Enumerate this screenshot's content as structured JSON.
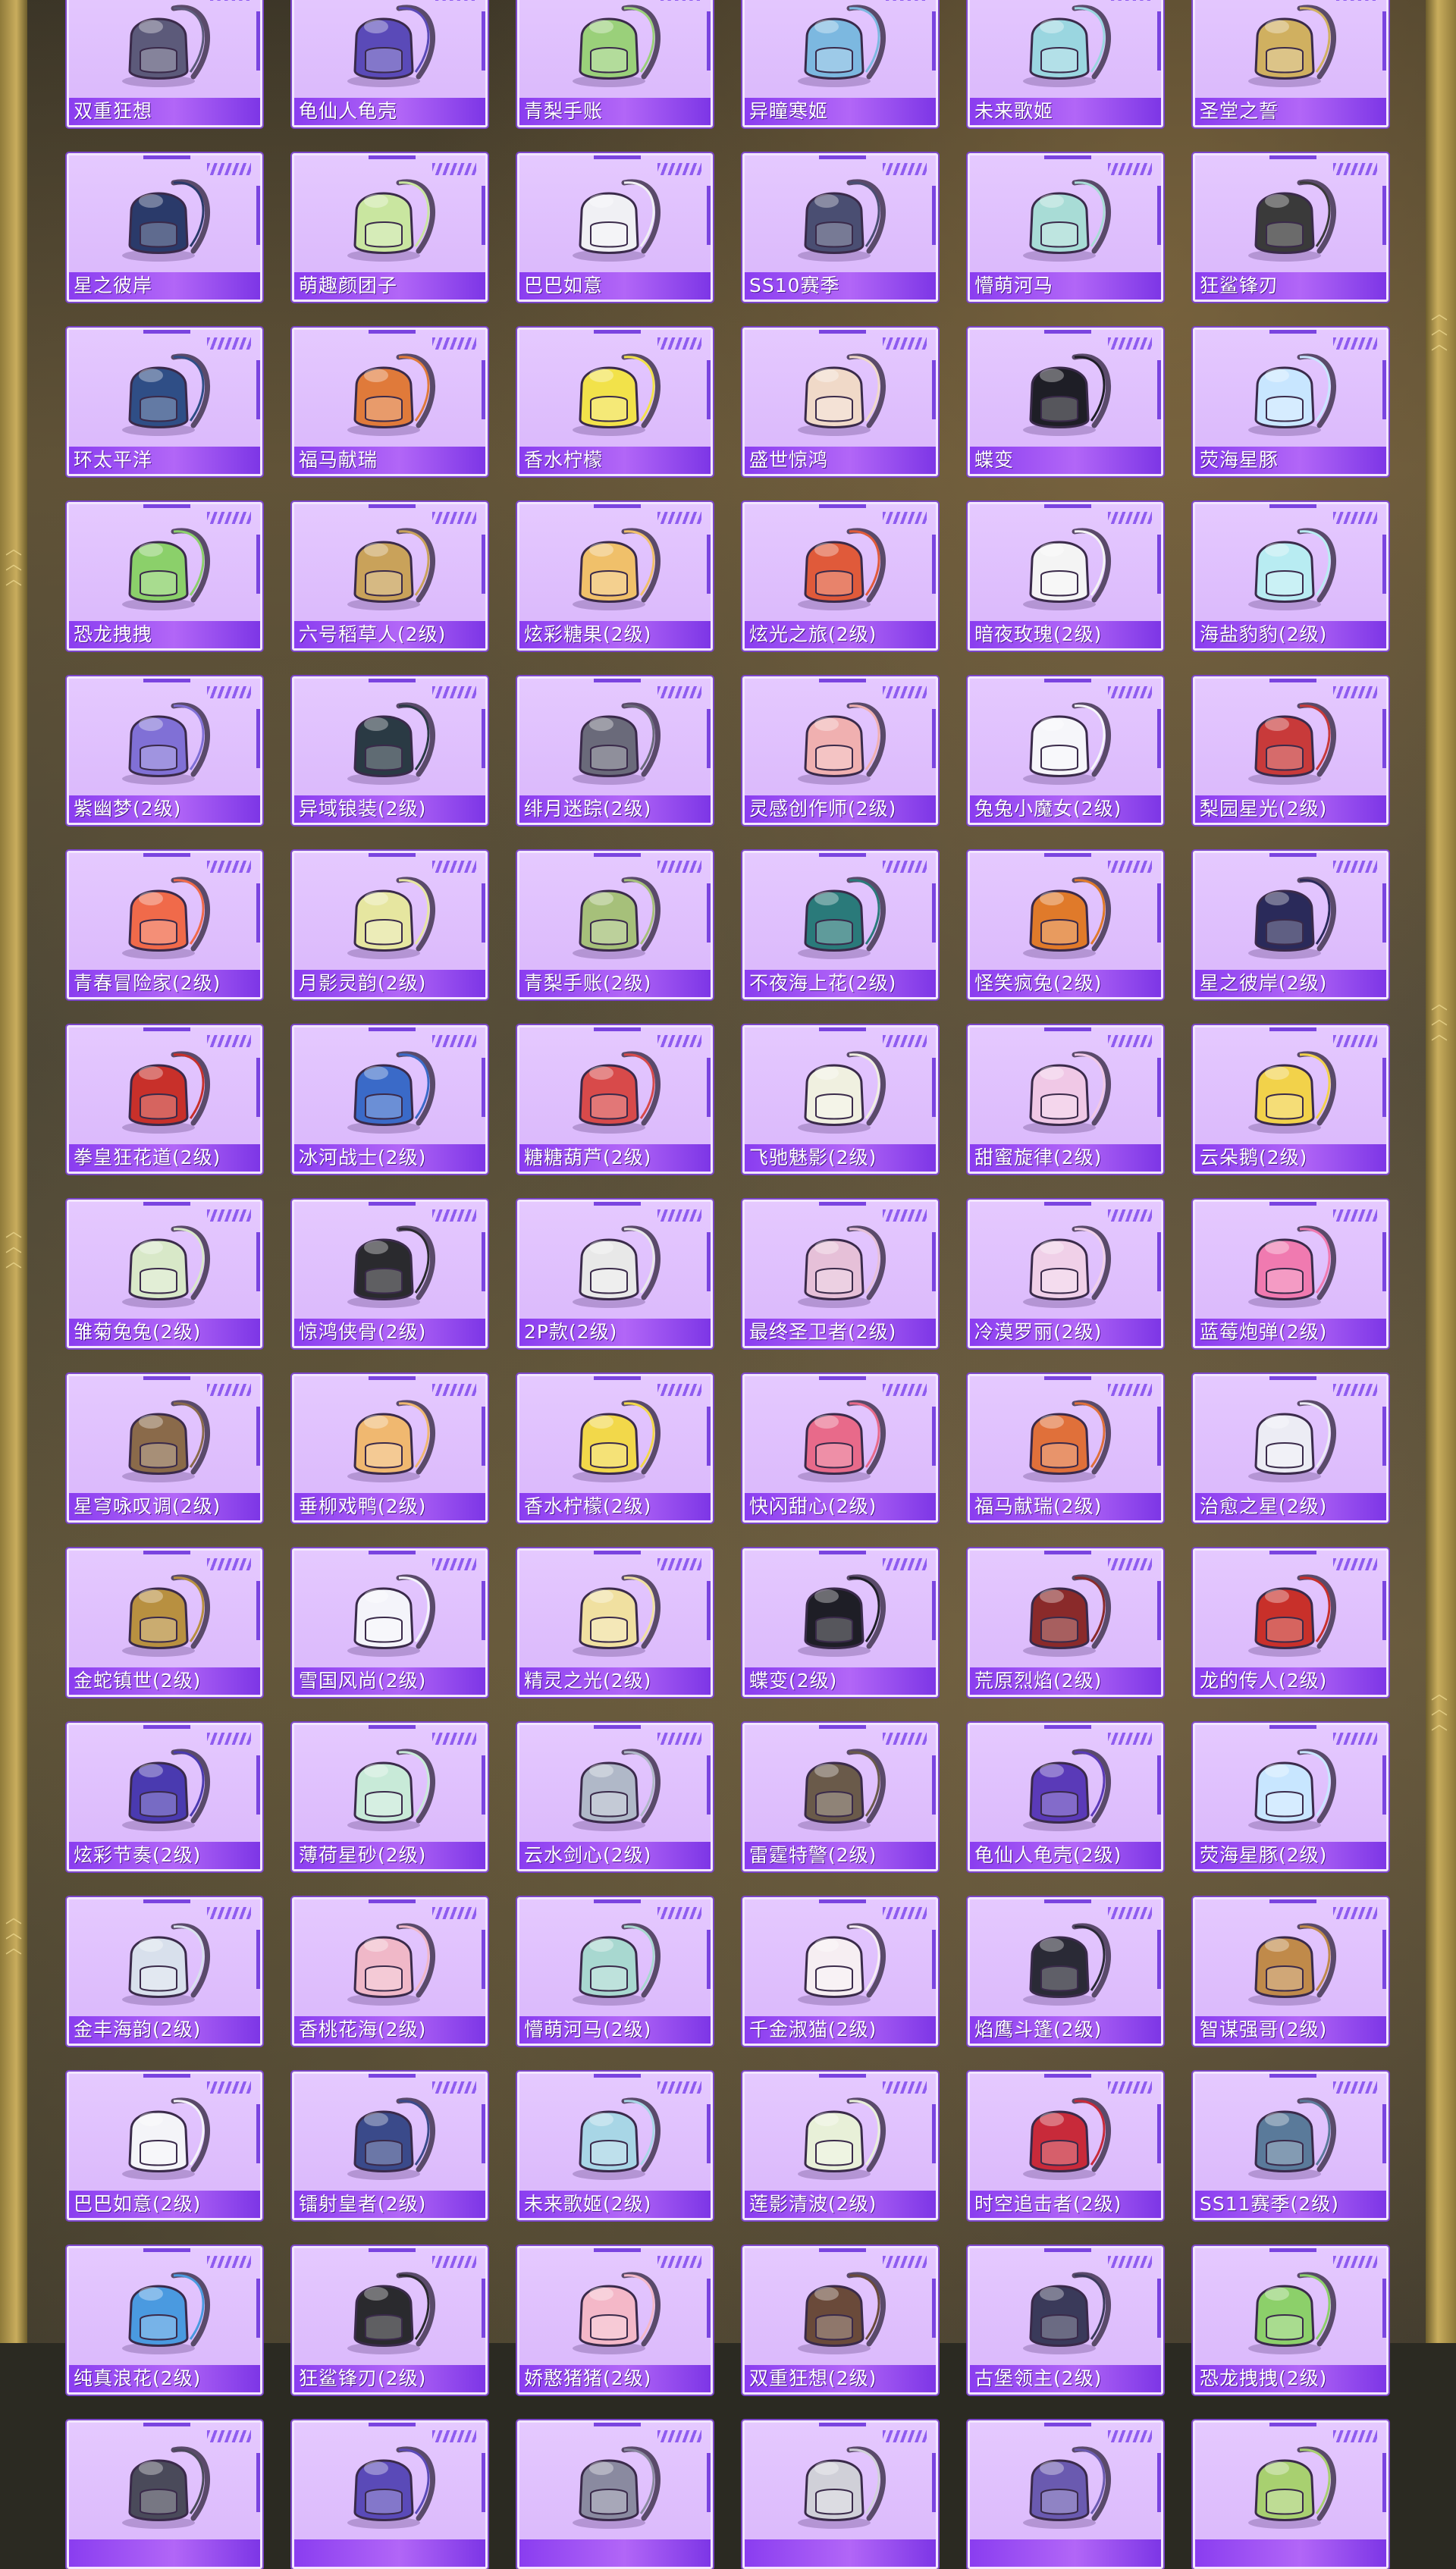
{
  "items": [
    {
      "name": "双重狂想",
      "color": "#5c5a7a"
    },
    {
      "name": "龟仙人龟壳",
      "color": "#5a4ab8"
    },
    {
      "name": "青梨手账",
      "color": "#9ad07a"
    },
    {
      "name": "异瞳寒姬",
      "color": "#7cb8e0"
    },
    {
      "name": "未来歌姬",
      "color": "#9ad6e0"
    },
    {
      "name": "圣堂之誓",
      "color": "#d0b060"
    },
    {
      "name": "星之彼岸",
      "color": "#2a3a6a"
    },
    {
      "name": "萌趣颜团子",
      "color": "#c9e6a0"
    },
    {
      "name": "巴巴如意",
      "color": "#f0f0f4"
    },
    {
      "name": "SS10赛季",
      "color": "#4a4e72"
    },
    {
      "name": "懵萌河马",
      "color": "#a8dcd6"
    },
    {
      "name": "狂鲨锋刃",
      "color": "#3a3a3a"
    },
    {
      "name": "环太平洋",
      "color": "#2f4e86"
    },
    {
      "name": "福马献瑞",
      "color": "#e07a3a"
    },
    {
      "name": "香水柠檬",
      "color": "#f2e24a"
    },
    {
      "name": "盛世惊鸿",
      "color": "#f0d9c8"
    },
    {
      "name": "蝶变",
      "color": "#1e1e26"
    },
    {
      "name": "荧海星豚",
      "color": "#c8e6ff"
    },
    {
      "name": "恐龙拽拽",
      "color": "#8bd06a"
    },
    {
      "name": "六号稻草人(2级)",
      "color": "#c9a25a"
    },
    {
      "name": "炫彩糖果(2级)",
      "color": "#f0c06a"
    },
    {
      "name": "炫光之旅(2级)",
      "color": "#e05a3a"
    },
    {
      "name": "暗夜玫瑰(2级)",
      "color": "#f4f4f4"
    },
    {
      "name": "海盐豹豹(2级)",
      "color": "#b8ecf2"
    },
    {
      "name": "紫幽梦(2级)",
      "color": "#8070d6"
    },
    {
      "name": "异域锒装(2级)",
      "color": "#2a3a44"
    },
    {
      "name": "绯月迷踪(2级)",
      "color": "#6a6a7a"
    },
    {
      "name": "灵感创作师(2级)",
      "color": "#f0b0b0"
    },
    {
      "name": "兔兔小魔女(2级)",
      "color": "#f6f6fa"
    },
    {
      "name": "梨园星光(2级)",
      "color": "#c83a3a"
    },
    {
      "name": "青春冒险家(2级)",
      "color": "#f06a4a"
    },
    {
      "name": "月影灵韵(2级)",
      "color": "#e6e6a0"
    },
    {
      "name": "青梨手账(2级)",
      "color": "#a6c07a"
    },
    {
      "name": "不夜海上花(2级)",
      "color": "#2a7a7a"
    },
    {
      "name": "怪笑疯兔(2级)",
      "color": "#e07a2a"
    },
    {
      "name": "星之彼岸(2级)",
      "color": "#2a2a5a"
    },
    {
      "name": "拳皇狂花道(2级)",
      "color": "#c8302a"
    },
    {
      "name": "冰河战士(2级)",
      "color": "#3a6ac8"
    },
    {
      "name": "糖糖葫芦(2级)",
      "color": "#d84a4a"
    },
    {
      "name": "飞驰魅影(2级)",
      "color": "#f0f0e0"
    },
    {
      "name": "甜蜜旋律(2级)",
      "color": "#f0c8e6"
    },
    {
      "name": "云朵鹅(2级)",
      "color": "#f2d24a"
    },
    {
      "name": "雏菊兔兔(2级)",
      "color": "#d8e8c8"
    },
    {
      "name": "惊鸿侠骨(2级)",
      "color": "#2a2a2e"
    },
    {
      "name": "2P款(2级)",
      "color": "#e8e8e8"
    },
    {
      "name": "最终圣卫者(2级)",
      "color": "#e6c0d8"
    },
    {
      "name": "冷漠罗丽(2级)",
      "color": "#f0d0e8"
    },
    {
      "name": "蓝莓炮弹(2级)",
      "color": "#f07ab0"
    },
    {
      "name": "星穹咏叹调(2级)",
      "color": "#8a6a4a"
    },
    {
      "name": "垂柳戏鸭(2级)",
      "color": "#f0b870"
    },
    {
      "name": "香水柠檬(2级)",
      "color": "#f2d84a"
    },
    {
      "name": "快闪甜心(2级)",
      "color": "#e86a8a"
    },
    {
      "name": "福马献瑞(2级)",
      "color": "#e0703a"
    },
    {
      "name": "治愈之星(2级)",
      "color": "#ececf4"
    },
    {
      "name": "金蛇镇世(2级)",
      "color": "#b89040"
    },
    {
      "name": "雪国风尚(2级)",
      "color": "#f4f4fa"
    },
    {
      "name": "精灵之光(2级)",
      "color": "#f0e0a0"
    },
    {
      "name": "蝶变(2级)",
      "color": "#1e1e26"
    },
    {
      "name": "荒原烈焰(2级)",
      "color": "#8a2a2a"
    },
    {
      "name": "龙的传人(2级)",
      "color": "#c8302a"
    },
    {
      "name": "炫彩节奏(2级)",
      "color": "#4a3ab0"
    },
    {
      "name": "薄荷星砂(2级)",
      "color": "#c8ead8"
    },
    {
      "name": "云水剑心(2级)",
      "color": "#b0b8c8"
    },
    {
      "name": "雷霆特警(2级)",
      "color": "#6a5a4a"
    },
    {
      "name": "龟仙人龟壳(2级)",
      "color": "#5a3ab8"
    },
    {
      "name": "荧海星豚(2级)",
      "color": "#c8e6ff"
    },
    {
      "name": "金丰海韵(2级)",
      "color": "#d8e0ec"
    },
    {
      "name": "香桃花海(2级)",
      "color": "#f0b8c8"
    },
    {
      "name": "懵萌河马(2级)",
      "color": "#a8d8d0"
    },
    {
      "name": "千金淑猫(2级)",
      "color": "#f6eef2"
    },
    {
      "name": "焰鹰斗篷(2级)",
      "color": "#2a2a36"
    },
    {
      "name": "智谋强哥(2级)",
      "color": "#c08a4a"
    },
    {
      "name": "巴巴如意(2级)",
      "color": "#f4f4f8"
    },
    {
      "name": "镭射皇者(2级)",
      "color": "#3a4a8a"
    },
    {
      "name": "未来歌姬(2级)",
      "color": "#a8d6e6"
    },
    {
      "name": "莲影清波(2级)",
      "color": "#e8f0d8"
    },
    {
      "name": "时空追击者(2级)",
      "color": "#c82a3a"
    },
    {
      "name": "SS11赛季(2级)",
      "color": "#5a7a9a"
    },
    {
      "name": "纯真浪花(2级)",
      "color": "#4a9ae0"
    },
    {
      "name": "狂鲨锋刃(2级)",
      "color": "#2a2a2e"
    },
    {
      "name": "娇憨猪猪(2级)",
      "color": "#f4b8c8"
    },
    {
      "name": "双重狂想(2级)",
      "color": "#6a4a3a"
    },
    {
      "name": "古堡领主(2级)",
      "color": "#3a3a5a"
    },
    {
      "name": "恐龙拽拽(2级)",
      "color": "#8cd06a"
    },
    {
      "name": "",
      "color": "#4a4a5a"
    },
    {
      "name": "",
      "color": "#5a4ab8"
    },
    {
      "name": "",
      "color": "#8a8aa0"
    },
    {
      "name": "",
      "color": "#d0d0d8"
    },
    {
      "name": "",
      "color": "#6a5ab0"
    },
    {
      "name": "",
      "color": "#a8d070"
    }
  ]
}
